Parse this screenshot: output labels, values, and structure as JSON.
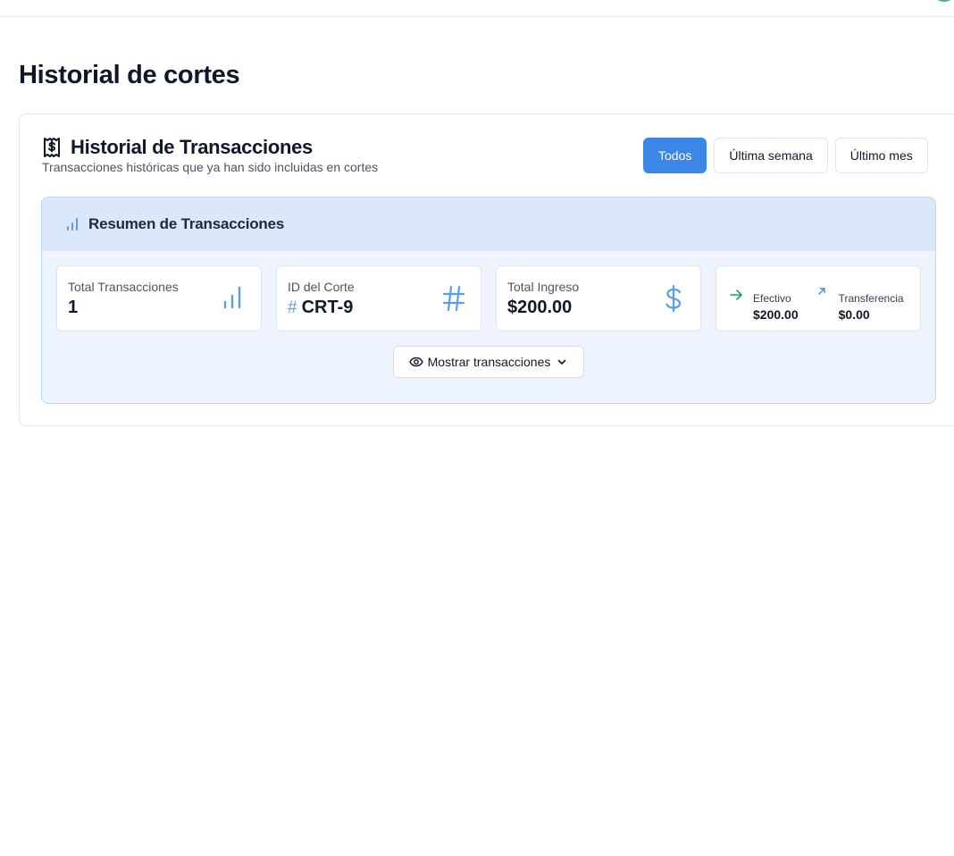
{
  "page": {
    "title": "Historial de cortes"
  },
  "card": {
    "title": "Historial de Transacciones",
    "subtitle": "Transacciones históricas que ya han sido incluidas en cortes",
    "filters": [
      {
        "label": "Todos",
        "active": true
      },
      {
        "label": "Última semana",
        "active": false
      },
      {
        "label": "Último mes",
        "active": false
      }
    ]
  },
  "summary": {
    "title": "Resumen de Transacciones",
    "stats": {
      "total_transactions": {
        "label": "Total Transacciones",
        "value": "1",
        "icon": "bar-chart-icon"
      },
      "cut_id": {
        "label": "ID del Corte",
        "prefix": "#",
        "value": "CRT-9",
        "icon": "hash-icon"
      },
      "total_income": {
        "label": "Total Ingreso",
        "value": "$200.00",
        "icon": "dollar-icon"
      },
      "breakdown": {
        "cash": {
          "label": "Efectivo",
          "value": "$200.00",
          "icon": "arrow-right-icon"
        },
        "transfer": {
          "label": "Transferencia",
          "value": "$0.00",
          "icon": "arrow-up-right-icon"
        }
      }
    },
    "toggle_label": "Mostrar transacciones"
  },
  "colors": {
    "accent": "#3b87e8",
    "summary_bg": "#edf4fe",
    "summary_header_bg": "#dbe8fb",
    "icon_blue": "#5b9bf0",
    "cash_green": "#22a355"
  }
}
